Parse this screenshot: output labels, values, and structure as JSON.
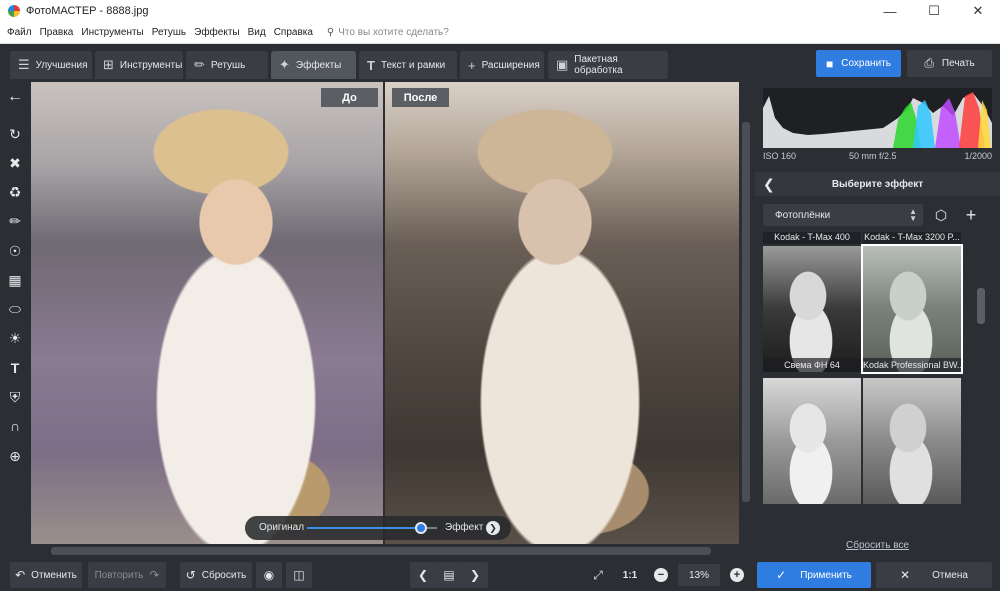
{
  "window": {
    "title": "ФотоМАСТЕР - 8888.jpg",
    "minimize_icon": "minimize-icon",
    "maximize_icon": "maximize-icon",
    "close_icon": "close-icon"
  },
  "menu": {
    "items": [
      "Файл",
      "Правка",
      "Инструменты",
      "Ретушь",
      "Эффекты",
      "Вид",
      "Справка"
    ],
    "search_placeholder": "Что вы хотите сделать?"
  },
  "toolbar": {
    "tabs": [
      {
        "label": "Улучшения",
        "icon": "sliders-icon",
        "active": false
      },
      {
        "label": "Инструменты",
        "icon": "crop-icon",
        "active": false
      },
      {
        "label": "Ретушь",
        "icon": "brush-icon",
        "active": false
      },
      {
        "label": "Эффекты",
        "icon": "magic-wand-icon",
        "active": true
      },
      {
        "label": "Текст и рамки",
        "icon": "text-icon",
        "active": false
      },
      {
        "label": "Расширения",
        "icon": "plus-icon",
        "active": false
      },
      {
        "label": "Пакетная обработка",
        "icon": "batch-icon",
        "active": false
      }
    ],
    "save_label": "Сохранить",
    "print_label": "Печать"
  },
  "left_tools": [
    "back-arrow-icon",
    "rotate-icon",
    "bandage-icon",
    "stamp-icon",
    "brush-icon",
    "radial-icon",
    "gradient-icon",
    "vignette-icon",
    "brightness-icon",
    "text-icon",
    "fill-icon",
    "magnet-icon",
    "target-icon"
  ],
  "canvas": {
    "before_label": "До",
    "after_label": "После",
    "slider_left_label": "Оригинал",
    "slider_right_label": "Эффект",
    "slider_value": 0.88
  },
  "histogram": {
    "iso": "ISO 160",
    "lens": "50 mm f/2.5",
    "shutter": "1/2000"
  },
  "effects_panel": {
    "header": "Выберите эффект",
    "category": "Фотоплёнки",
    "top_captions": [
      "Kodak - T-Max 400",
      "Kodak - T-Max 3200 P..."
    ],
    "items": [
      {
        "caption": "Свема ФН 64",
        "selected": false
      },
      {
        "caption": "Kodak Professional BW...",
        "selected": true
      },
      {
        "caption": "",
        "selected": false
      },
      {
        "caption": "",
        "selected": false
      }
    ],
    "reset_all": "Сбросить все"
  },
  "bottom": {
    "undo_label": "Отменить",
    "redo_label": "Повторить",
    "reset_label": "Сбросить",
    "fit_label": "1:1",
    "zoom": "13%",
    "apply_label": "Применить",
    "cancel_label": "Отмена"
  },
  "colors": {
    "accent": "#2f7de1",
    "bg": "#2b2e33",
    "tab_active": "#52565d"
  }
}
